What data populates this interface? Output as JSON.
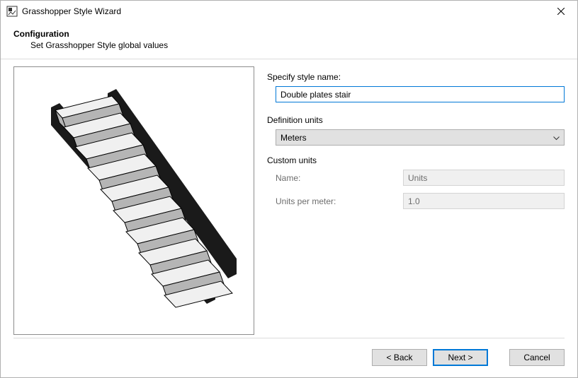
{
  "window": {
    "title": "Grasshopper Style Wizard"
  },
  "header": {
    "heading": "Configuration",
    "subheading": "Set Grasshopper Style global values"
  },
  "form": {
    "style_name_label": "Specify style name:",
    "style_name_value": "Double plates stair",
    "definition_units_label": "Definition units",
    "definition_units_value": "Meters",
    "custom_units_label": "Custom units",
    "custom_name_label": "Name:",
    "custom_name_value": "Units",
    "custom_upm_label": "Units per meter:",
    "custom_upm_value": "1.0"
  },
  "footer": {
    "back": "< Back",
    "next": "Next >",
    "cancel": "Cancel"
  }
}
